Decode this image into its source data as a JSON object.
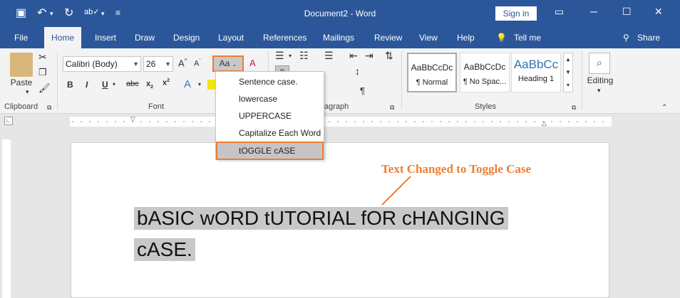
{
  "titlebar": {
    "title": "Document2 - Word",
    "signin": "Sign in",
    "colors": {
      "brand": "#2b579a",
      "accent": "#ed7d31"
    }
  },
  "tabs": [
    "File",
    "Home",
    "Insert",
    "Draw",
    "Design",
    "Layout",
    "References",
    "Mailings",
    "Review",
    "View",
    "Help"
  ],
  "tell_me": "Tell me",
  "share": "Share",
  "clipboard": {
    "paste": "Paste",
    "label": "Clipboard"
  },
  "font": {
    "family": "Calibri (Body)",
    "size": "26",
    "label": "Font",
    "change_case": "Aa"
  },
  "paragraph": {
    "label": "agraph"
  },
  "styles": {
    "label": "Styles",
    "items": [
      {
        "sample": "AaBbCcDc",
        "name": "¶ Normal"
      },
      {
        "sample": "AaBbCcDc",
        "name": "¶ No Spac..."
      },
      {
        "sample": "AaBbCc",
        "name": "Heading 1"
      }
    ]
  },
  "editing": {
    "label": "Editing"
  },
  "case_menu": {
    "items": [
      "Sentence case.",
      "lowercase",
      "UPPERCASE",
      "Capitalize Each Word",
      "tOGGLE cASE"
    ],
    "selected": "tOGGLE cASE"
  },
  "document": {
    "line1": "bASIC wORD tUTORIAL fOR cHANGING",
    "line2": "cASE."
  },
  "annotation": "Text Changed to Toggle Case"
}
